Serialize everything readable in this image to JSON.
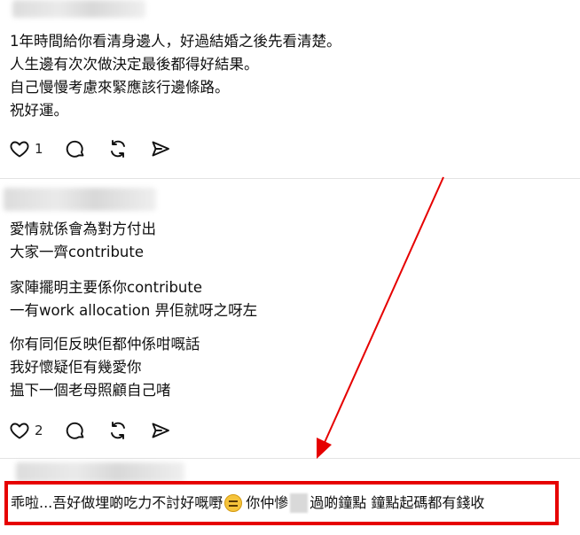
{
  "posts": [
    {
      "lines": [
        "1年時間給你看清身邊人，好過結婚之後先看清楚。",
        "人生邊有次次做決定最後都得好結果。",
        "自己慢慢考慮來緊應該行邊條路。",
        "祝好運。"
      ],
      "like_count": "1"
    },
    {
      "paragraphs": [
        [
          "愛情就係會為對方付出",
          "大家一齊contribute"
        ],
        [
          "家陣擺明主要係你contribute",
          "一有work allocation 畀佢就呀之呀左"
        ],
        [
          "你有同佢反映佢都仲係咁嘅話",
          "我好懷疑佢有幾愛你",
          "揾下一個老母照顧自己啫"
        ]
      ],
      "like_count": "2"
    }
  ],
  "highlighted_comment": {
    "part1": "乖啦...吾好做埋啲吃力不討好嘅嘢",
    "part2": "你仲慘",
    "part3": "過啲鐘點 鐘點起碼都有錢收"
  },
  "icons": {
    "like": "heart-icon",
    "comment": "speech-bubble-icon",
    "repost": "repost-arrows-icon",
    "share": "send-icon"
  },
  "colors": {
    "highlight": "#e60000",
    "arrow": "#e60000"
  }
}
